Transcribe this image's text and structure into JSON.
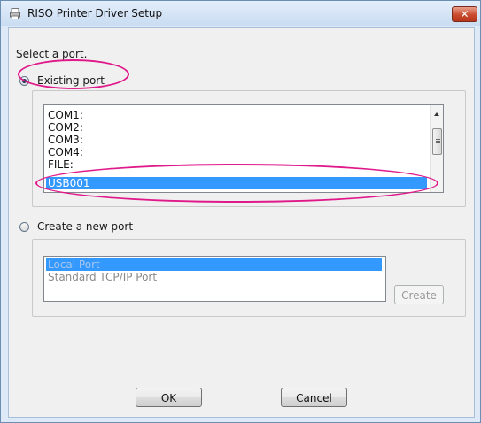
{
  "window": {
    "title": "RISO Printer Driver Setup",
    "close_glyph": "✕"
  },
  "dialog": {
    "prompt": "Select a port.",
    "existing_port": {
      "label": "Existing port",
      "selected": true,
      "ports": [
        "COM1:",
        "COM2:",
        "COM3:",
        "COM4:",
        "FILE:",
        "USB001"
      ],
      "selected_port": "USB001"
    },
    "new_port": {
      "label": "Create a new port",
      "selected": false,
      "port_types": [
        "Local Port",
        "Standard TCP/IP Port"
      ],
      "selected_type": "Local Port",
      "create_label": "Create"
    },
    "ok_label": "OK",
    "cancel_label": "Cancel"
  },
  "colors": {
    "selection": "#3399ff",
    "highlight_annotation": "#e0198a",
    "window_frame": "#dde9f6"
  }
}
